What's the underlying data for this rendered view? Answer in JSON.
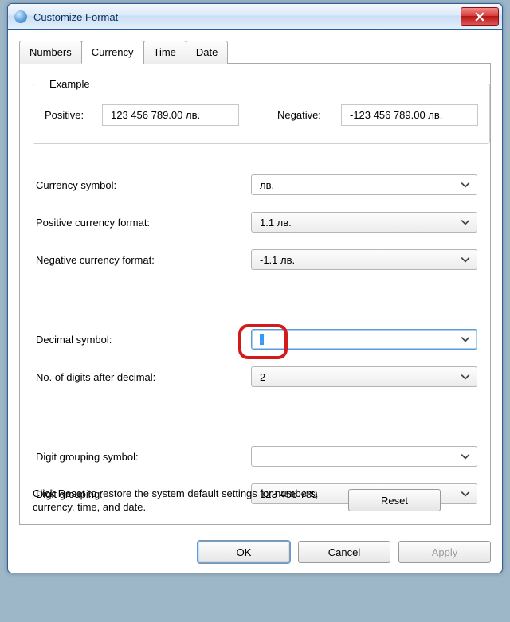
{
  "window": {
    "title": "Customize Format"
  },
  "tabs": {
    "numbers": "Numbers",
    "currency": "Currency",
    "time": "Time",
    "date": "Date",
    "active": "currency"
  },
  "example": {
    "legend": "Example",
    "positive_label": "Positive:",
    "positive_value": "123 456 789.00 лв.",
    "negative_label": "Negative:",
    "negative_value": "-123 456 789.00 лв."
  },
  "fields": {
    "currency_symbol": {
      "label": "Currency symbol:",
      "value": "лв."
    },
    "positive_format": {
      "label": "Positive currency format:",
      "value": "1.1 лв."
    },
    "negative_format": {
      "label": "Negative currency format:",
      "value": "-1.1 лв."
    },
    "decimal_symbol": {
      "label": "Decimal symbol:",
      "value": "."
    },
    "digits_after": {
      "label": "No. of digits after decimal:",
      "value": "2"
    },
    "grouping_symbol": {
      "label": "Digit grouping symbol:",
      "value": ""
    },
    "grouping": {
      "label": "Digit grouping:",
      "value": "123 456 789"
    }
  },
  "reset": {
    "note": "Click Reset to restore the system default settings for numbers, currency, time, and date.",
    "button": "Reset"
  },
  "buttons": {
    "ok": "OK",
    "cancel": "Cancel",
    "apply": "Apply"
  }
}
